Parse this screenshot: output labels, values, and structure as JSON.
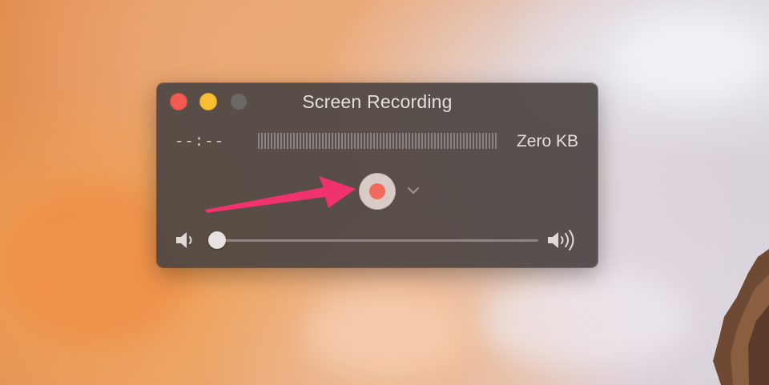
{
  "window": {
    "title": "Screen Recording",
    "time": "--:--",
    "file_size": "Zero KB"
  },
  "controls": {
    "record_icon": "record-icon",
    "chevron_icon": "chevron-down-icon",
    "volume_low_icon": "speaker-low-icon",
    "volume_high_icon": "speaker-high-icon",
    "volume_level": 0
  },
  "colors": {
    "close": "#f05b53",
    "minimize": "#f7be2f",
    "record_dot": "#f26a5d",
    "annotation_arrow": "#f0326e"
  }
}
